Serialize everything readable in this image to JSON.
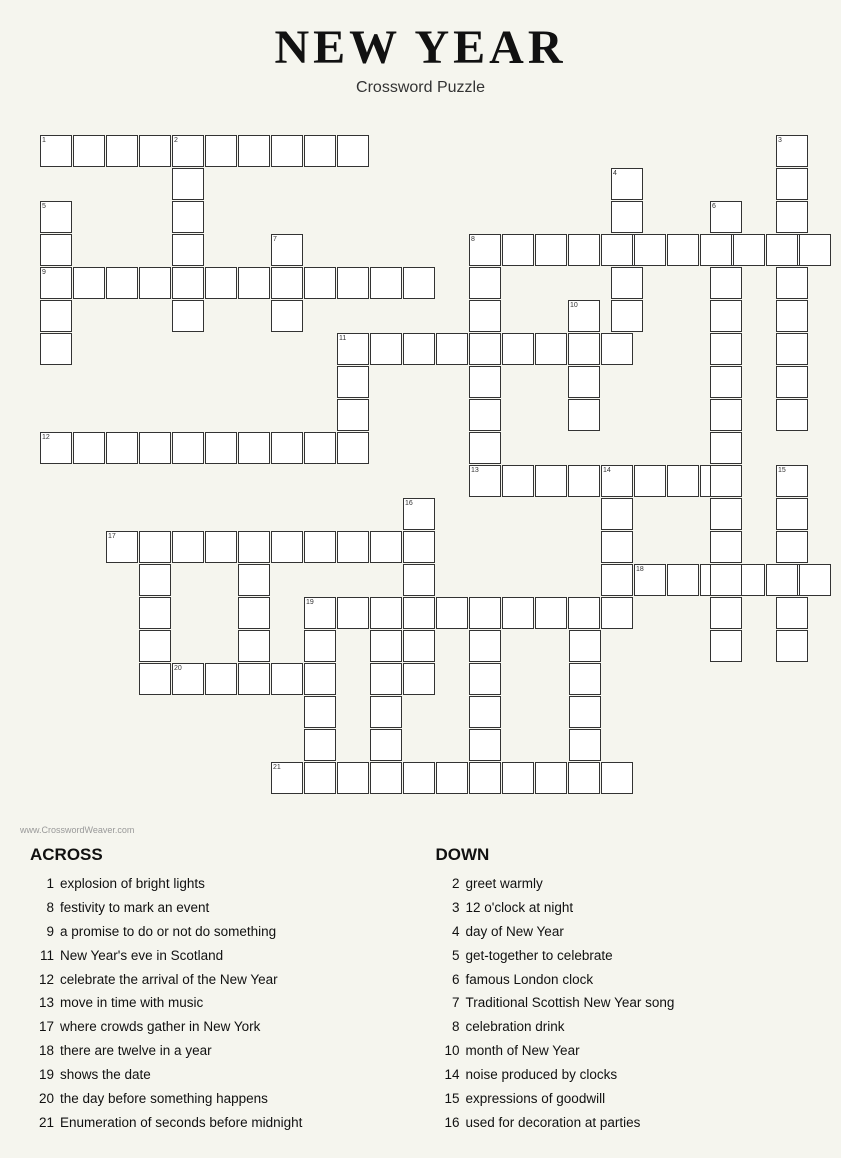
{
  "title": "NEW YEAR",
  "subtitle": "Crossword Puzzle",
  "watermark": "www.CrosswordWeaver.com",
  "across_header": "ACROSS",
  "down_header": "DOWN",
  "across_clues": [
    {
      "num": "1",
      "text": "explosion of bright lights"
    },
    {
      "num": "8",
      "text": "festivity to mark an event"
    },
    {
      "num": "9",
      "text": "a promise to do or not do something"
    },
    {
      "num": "11",
      "text": "New Year's eve in Scotland"
    },
    {
      "num": "12",
      "text": "celebrate the arrival of the New Year"
    },
    {
      "num": "13",
      "text": "move in time with music"
    },
    {
      "num": "17",
      "text": "where crowds gather in New York"
    },
    {
      "num": "18",
      "text": "there are twelve in a year"
    },
    {
      "num": "19",
      "text": "shows the date"
    },
    {
      "num": "20",
      "text": "the day before something happens"
    },
    {
      "num": "21",
      "text": "Enumeration of seconds before midnight"
    }
  ],
  "down_clues": [
    {
      "num": "2",
      "text": "greet warmly"
    },
    {
      "num": "3",
      "text": "12 o'clock at night"
    },
    {
      "num": "4",
      "text": "day of New Year"
    },
    {
      "num": "5",
      "text": "get-together to celebrate"
    },
    {
      "num": "6",
      "text": "famous London clock"
    },
    {
      "num": "7",
      "text": "Traditional Scottish New Year song"
    },
    {
      "num": "8",
      "text": "celebration drink"
    },
    {
      "num": "10",
      "text": "month of New Year"
    },
    {
      "num": "14",
      "text": "noise produced by clocks"
    },
    {
      "num": "15",
      "text": "expressions of goodwill"
    },
    {
      "num": "16",
      "text": "used for decoration at parties"
    }
  ]
}
